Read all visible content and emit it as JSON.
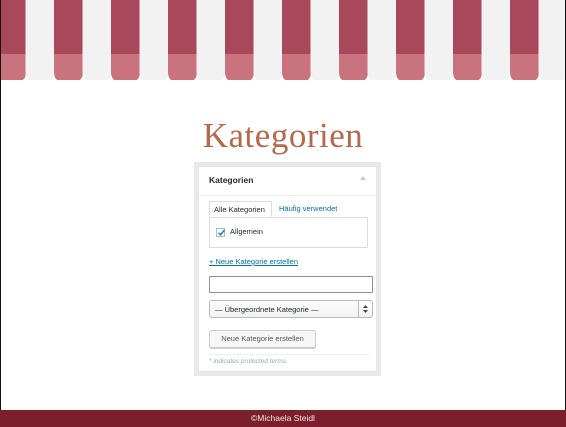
{
  "page": {
    "title": "Kategorien",
    "footer": "©Michaela Steidl"
  },
  "colors": {
    "awning_stripe": "#a8485a",
    "awning_scallop": "#c9737f",
    "awning_white": "#f2f2f2",
    "title": "#b5684a",
    "footer_bg": "#7a1f2b",
    "link": "#0073aa"
  },
  "metabox": {
    "title": "Kategorien",
    "toggle_icon": "triangle-up-icon",
    "tabs": [
      {
        "label": "Alle Kategorien",
        "active": true
      },
      {
        "label": "Häufig verwendet",
        "active": false
      }
    ],
    "categories": [
      {
        "label": "Allgemein",
        "checked": true
      }
    ],
    "add_link": "+ Neue Kategorie erstellen",
    "new_category_value": "",
    "parent_select": {
      "selected": "— Übergeordnete Kategorie —"
    },
    "submit_label": "Neue Kategorie erstellen",
    "note": "* indicates protected terms."
  }
}
